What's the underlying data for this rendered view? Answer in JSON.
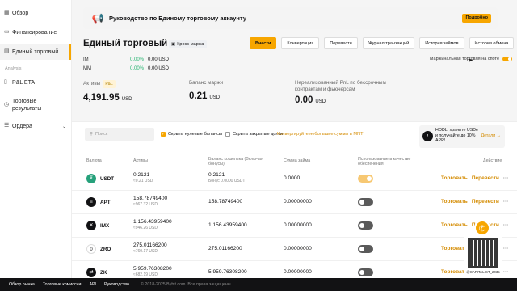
{
  "sidebar": {
    "items": [
      {
        "label": "Обзор",
        "icon": "grid-icon"
      },
      {
        "label": "Финансирование",
        "icon": "wallet-icon"
      },
      {
        "label": "Единый торговый",
        "icon": "chart-icon"
      }
    ],
    "section": "Analysis",
    "items2": [
      {
        "label": "P&L ETA",
        "icon": "doc-icon"
      },
      {
        "label": "Торговые результаты",
        "icon": "clock-icon"
      },
      {
        "label": "Ордера",
        "icon": "list-icon"
      }
    ]
  },
  "banner": {
    "title": "Руководство по Единому торговому аккаунту",
    "button": "Подробно"
  },
  "page": {
    "title": "Единый торговый",
    "chip": "Кросс-маржа"
  },
  "toolbar": [
    "Внести",
    "Конвертация",
    "Перевести",
    "Журнал транзакций",
    "История займов",
    "История обмена"
  ],
  "im": {
    "label": "IM",
    "pct": "0.00%",
    "val": "0.00 USD"
  },
  "mm": {
    "label": "MM",
    "pct": "0.00%",
    "val": "0.00 USD"
  },
  "spot_margin": {
    "label": "Маржинальная торговля на споте",
    "on": true
  },
  "metrics": {
    "assets": {
      "label": "Активы",
      "badge": "P&L",
      "value": "4,191.95",
      "unit": "USD"
    },
    "margin": {
      "label": "Баланс маржи",
      "value": "0.21",
      "unit": "USD"
    },
    "pnl": {
      "label": "Нереализованный PnL по бессрочным контрактам и фьючерсам",
      "value": "0.00",
      "unit": "USD"
    }
  },
  "filters": {
    "search_placeholder": "Поиск",
    "hide_zero": "Скрыть нулевые балансы",
    "hide_closed": "Скрыть закрытые долги",
    "convert": "Конвертируйте небольшие суммы в MNT"
  },
  "promo": {
    "text": "HODL: храните USDe и получайте до 10% APR!",
    "link": "Детали"
  },
  "table": {
    "headers": [
      "Валюта",
      "Активы",
      "Баланс кошелька (Включая бонусы)",
      "Сумма займа",
      "Использование в качестве обеспечения",
      "Действие"
    ],
    "rows": [
      {
        "coin": "USDT",
        "color": "#26a17b",
        "sym": "₮",
        "assets": "0.2121",
        "assets_sub": "≈0.21 USD",
        "wallet": "0.2121",
        "wallet_sub": "Бонус 0.0000 USDT",
        "loan": "0.0000",
        "collateral": true
      },
      {
        "coin": "APT",
        "color": "#121214",
        "sym": "≡",
        "assets": "158.78749400",
        "assets_sub": "≈967.32 USD",
        "wallet": "158.78749400",
        "wallet_sub": "",
        "loan": "0.00000000",
        "collateral": false
      },
      {
        "coin": "IMX",
        "color": "#121214",
        "sym": "✕",
        "assets": "1,156.43959400",
        "assets_sub": "≈946.26 USD",
        "wallet": "1,156.43959400",
        "wallet_sub": "",
        "loan": "0.00000000",
        "collateral": false
      },
      {
        "coin": "ZRO",
        "color": "#fff",
        "sym": "0",
        "assets": "275.01166200",
        "assets_sub": "≈760.17 USD",
        "wallet": "275.01166200",
        "wallet_sub": "",
        "loan": "0.00000000",
        "collateral": false
      },
      {
        "coin": "ZK",
        "color": "#121214",
        "sym": "⇄",
        "assets": "5,959.76308200",
        "assets_sub": "≈682.19 USD",
        "wallet": "5,959.76308200",
        "wallet_sub": "",
        "loan": "0.00000000",
        "collateral": false
      }
    ],
    "action_trade": "Торговать",
    "action_transfer": "Перевести",
    "action_more": "···"
  },
  "footer": {
    "links": [
      "Обзор рынка",
      "Торговые комиссии",
      "API",
      "Руководство"
    ],
    "copyright": "© 2018-2025 Bybit.com. Все права защищены."
  },
  "watermark": "@CAPITALIST_2035"
}
